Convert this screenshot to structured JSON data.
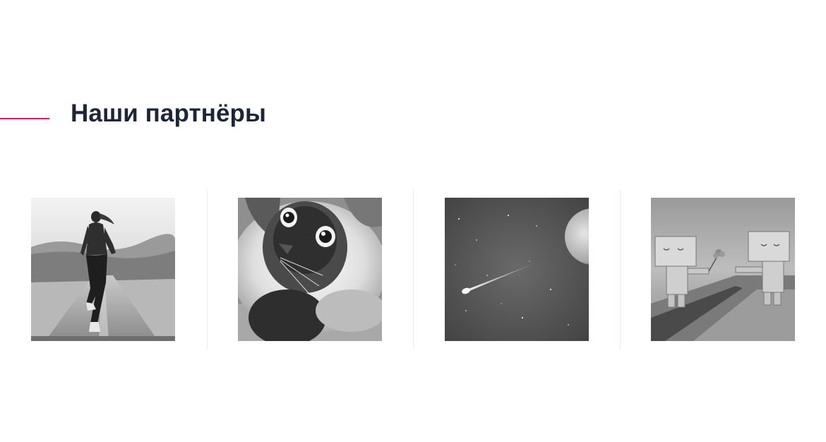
{
  "section": {
    "title": "Наши партнёры",
    "accent_color": "#d6245a"
  },
  "partners": [
    {
      "icon": "runner-photo"
    },
    {
      "icon": "cat-photo"
    },
    {
      "icon": "space-planet-photo"
    },
    {
      "icon": "cardboard-robots-photo"
    }
  ]
}
